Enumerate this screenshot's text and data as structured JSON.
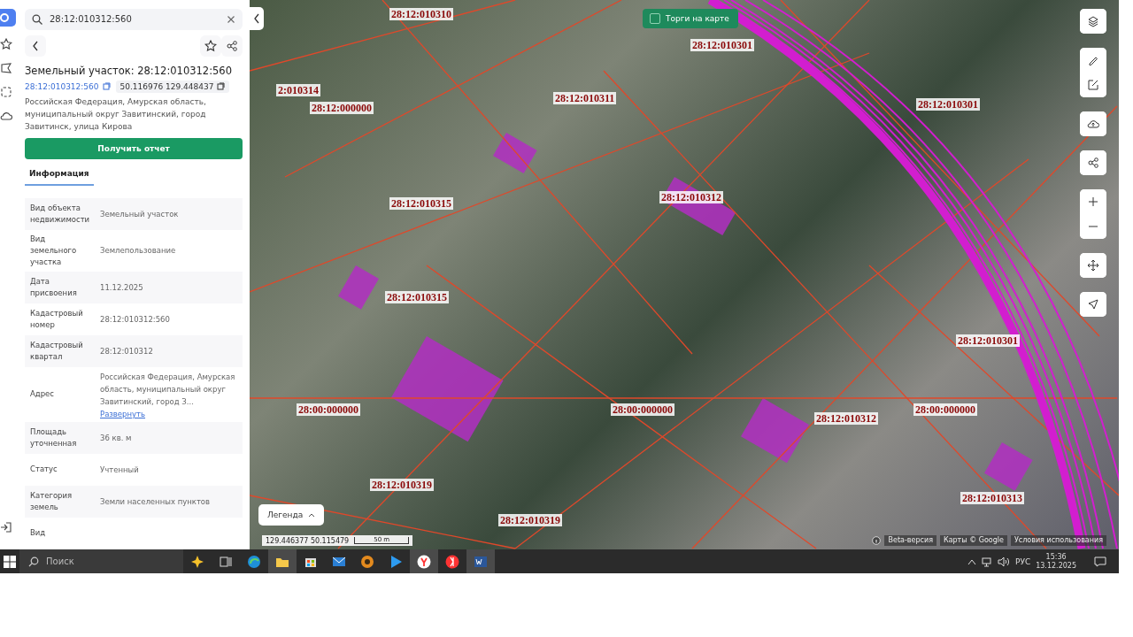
{
  "search": {
    "value": "28:12:010312:560"
  },
  "object": {
    "title": "Земельный участок: 28:12:010312:560",
    "cadastral_number": "28:12:010312:560",
    "coordinates": "50.116976 129.448437",
    "address": "Российская Федерация, Амурская область, муниципальный округ Завитинский, город Завитинск, улица Кирова"
  },
  "report_button": "Получить отчет",
  "tabs": [
    {
      "label": "Информация",
      "selected": true
    }
  ],
  "info_rows": [
    {
      "label": "Вид объекта недвижимости",
      "value": "Земельный участок"
    },
    {
      "label": "Вид земельного участка",
      "value": "Землепользование"
    },
    {
      "label": "Дата присвоения",
      "value": "11.12.2025"
    },
    {
      "label": "Кадастровый номер",
      "value": "28:12:010312:560"
    },
    {
      "label": "Кадастровый квартал",
      "value": "28:12:010312"
    },
    {
      "label": "Адрес",
      "value": "Российская Федерация, Амурская область, муниципальный округ Завитинский, город З...",
      "link": "Развернуть"
    },
    {
      "label": "Площадь уточненная",
      "value": "36 кв. м"
    },
    {
      "label": "Статус",
      "value": "Учтенный"
    },
    {
      "label": "Категория земель",
      "value": "Земли населенных пунктов"
    },
    {
      "label": "Вид"
    }
  ],
  "map": {
    "auction_toggle": {
      "label": "Торги на карте",
      "checked": false
    },
    "labels": [
      "28:12:010310",
      "28:12:010301",
      "2:010314",
      "28:12:000000",
      "28:12:010311",
      "28:12:010301",
      "28:12:010312",
      "28:12:010315",
      "28:12:010315",
      "28:12:010301",
      "28:00:000000",
      "28:00:000000",
      "28:12:010312",
      "28:00:000000",
      "28:12:010319",
      "28:12:010319",
      "28:12:010313"
    ],
    "legend_button": "Легенда",
    "coordinates": "129.446377 50.115479",
    "scale": "50 m",
    "attribution": [
      "Beta-версия",
      "Карты © Google",
      "Условия использования"
    ]
  },
  "taskbar": {
    "search_placeholder": "Поиск",
    "language": "РУС",
    "time": "15:36",
    "date": "13.12.2025"
  }
}
